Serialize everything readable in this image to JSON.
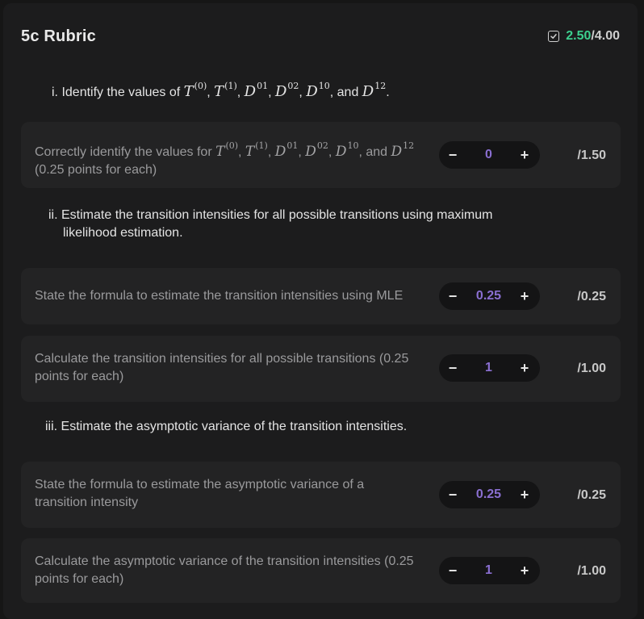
{
  "header": {
    "title": "5c Rubric",
    "earned": "2.50",
    "total": "/4.00",
    "accent": "#3ccf8e"
  },
  "sections": [
    {
      "heading_prefix": "i. Identify the values of ",
      "heading_suffix": ", and ",
      "heading_end": "."
    },
    {
      "heading_line1": "ii. Estimate the transition intensities for all possible transitions using maximum",
      "heading_line2": "likelihood estimation."
    },
    {
      "heading": "iii. Estimate the asymptotic variance of the transition intensities."
    }
  ],
  "math": {
    "T": "T",
    "D": "D",
    "s0": "(0)",
    "s1": "(1)",
    "d01": "01",
    "d02": "02",
    "d10": "10",
    "d12": "12",
    "comma": ", "
  },
  "criteria": [
    {
      "text_prefix": "Correctly identify the values for ",
      "text_and": ", and ",
      "text_line2": "(0.25 points for each)",
      "value": "0",
      "max": "/1.50"
    },
    {
      "text": "State the formula to estimate the transition intensities using MLE",
      "value": "0.25",
      "max": "/0.25"
    },
    {
      "text_line1": "Calculate the transition intensities for all possible transitions (0.25",
      "text_line2": "points for each)",
      "value": "1",
      "max": "/1.00"
    },
    {
      "text_line1": "State the formula to estimate the asymptotic variance of a",
      "text_line2": "transition intensity",
      "value": "0.25",
      "max": "/0.25"
    },
    {
      "text_line1": "Calculate the asymptotic variance of the transition intensities (0.25",
      "text_line2": "points for each)",
      "value": "1",
      "max": "/1.00"
    }
  ],
  "stepper": {
    "minus": "−",
    "plus": "+"
  },
  "colors": {
    "value": "#8a6fd1",
    "card": "#232324",
    "panel": "#1c1c1d"
  }
}
